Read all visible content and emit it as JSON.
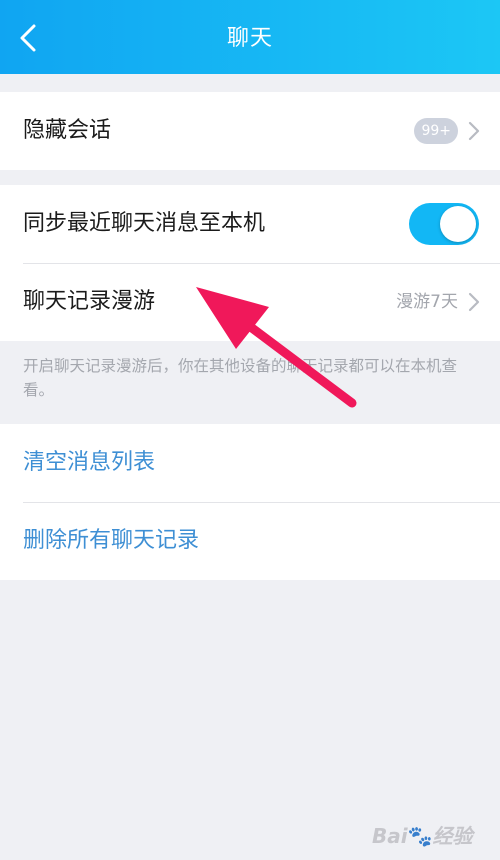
{
  "header": {
    "title": "聊天",
    "back_icon": "chevron-left-icon"
  },
  "hidden_chats": {
    "label": "隐藏会话",
    "badge": "99+"
  },
  "sync": {
    "label": "同步最近聊天消息至本机",
    "enabled": true
  },
  "roaming": {
    "label": "聊天记录漫游",
    "value": "漫游7天"
  },
  "roaming_note": "开启聊天记录漫游后，你在其他设备的聊天记录都可以在本机查看。",
  "actions": {
    "clear_list": "清空消息列表",
    "delete_all": "删除所有聊天记录"
  },
  "colors": {
    "header_gradient_start": "#10a5f2",
    "header_gradient_end": "#1cc7f5",
    "toggle_on": "#12b7f5",
    "action_link": "#3e8fd4",
    "annotation_arrow": "#f0185a"
  },
  "watermark": {
    "text": "Bai",
    "suffix": "经验"
  }
}
